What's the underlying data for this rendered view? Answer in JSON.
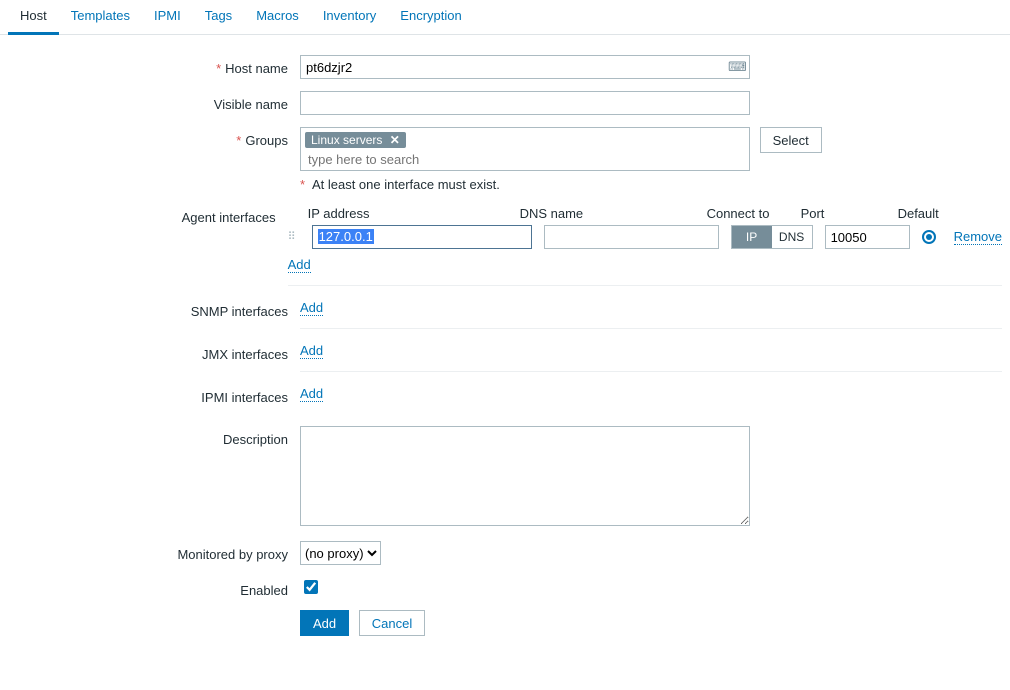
{
  "tabs": [
    {
      "label": "Host",
      "active": true
    },
    {
      "label": "Templates"
    },
    {
      "label": "IPMI"
    },
    {
      "label": "Tags"
    },
    {
      "label": "Macros"
    },
    {
      "label": "Inventory"
    },
    {
      "label": "Encryption"
    }
  ],
  "labels": {
    "host_name": "Host name",
    "visible_name": "Visible name",
    "groups": "Groups",
    "agent_interfaces": "Agent interfaces",
    "snmp_interfaces": "SNMP interfaces",
    "jmx_interfaces": "JMX interfaces",
    "ipmi_interfaces": "IPMI interfaces",
    "description": "Description",
    "monitored_by_proxy": "Monitored by proxy",
    "enabled": "Enabled"
  },
  "values": {
    "host_name": "pt6dzjr2",
    "visible_name": "",
    "description": "",
    "enabled": true,
    "proxy": "(no proxy)"
  },
  "groups": {
    "selected": [
      "Linux servers"
    ],
    "placeholder": "type here to search",
    "select_btn": "Select"
  },
  "interface_warning": "* At least one interface must exist.",
  "iface_headers": {
    "ip": "IP address",
    "dns": "DNS name",
    "connect": "Connect to",
    "port": "Port",
    "default": "Default"
  },
  "agent_iface": {
    "ip": "127.0.0.1",
    "dns": "",
    "connect_ip": "IP",
    "connect_dns": "DNS",
    "port": "10050",
    "remove": "Remove"
  },
  "add_link": "Add",
  "buttons": {
    "add": "Add",
    "cancel": "Cancel"
  }
}
